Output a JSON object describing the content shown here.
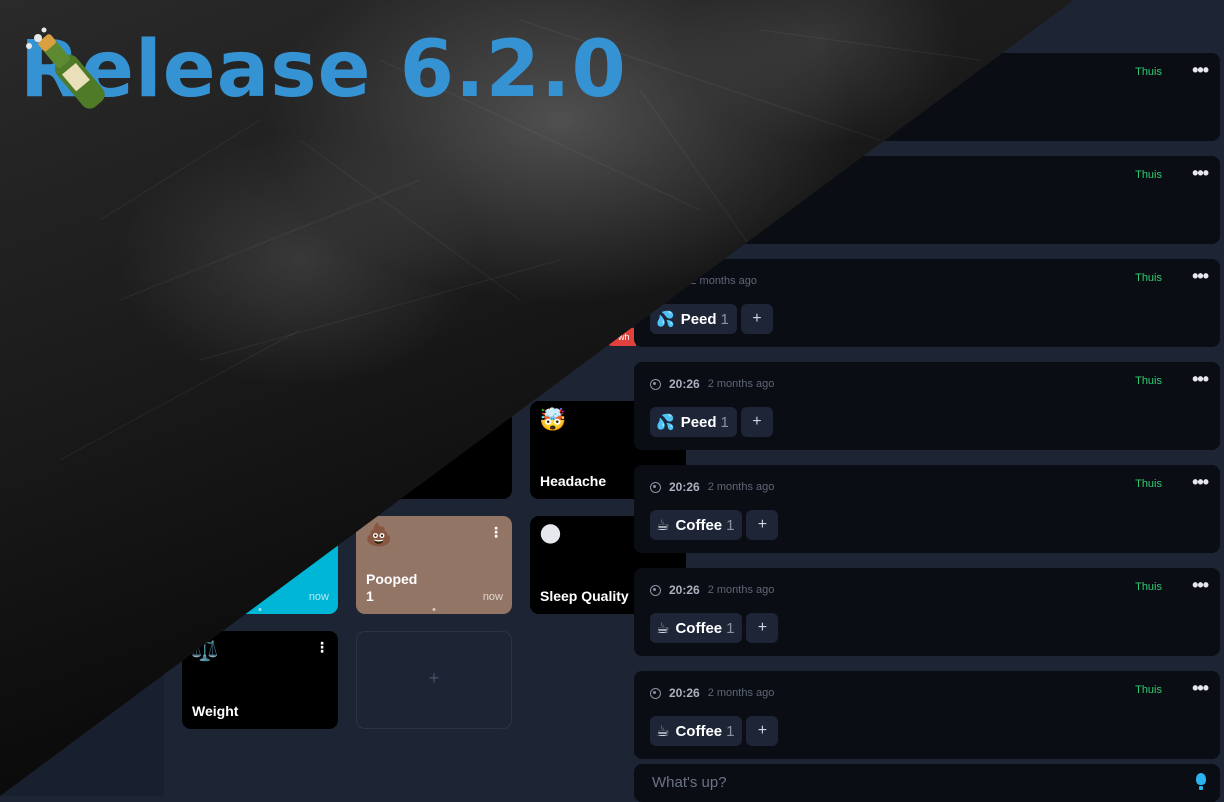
{
  "hero": {
    "title": "Release 6.2.0",
    "icon": "champagne-bottle-icon"
  },
  "tiles": {
    "headache": {
      "emoji": "🤯",
      "label": "Headache"
    },
    "pooped": {
      "emoji": "💩",
      "label": "Pooped",
      "count": "1",
      "time": "now",
      "color": "#937566"
    },
    "cyan": {
      "time": "now",
      "color": "#00b6d6"
    },
    "sleep": {
      "emoji": "🌑",
      "label": "Sleep Quality"
    },
    "weight": {
      "emoji": "⚖️",
      "label": "Weight"
    },
    "add": {
      "label": "+"
    },
    "red_chip": {
      "text": "wh"
    }
  },
  "feed": {
    "cards": [
      {
        "time": "",
        "ago": "",
        "tag": "Thuis",
        "menu": "•••",
        "chips": []
      },
      {
        "time": "",
        "ago": "",
        "tag": "Thuis",
        "menu": "•••",
        "chips": []
      },
      {
        "time": "26",
        "ago": "2 months ago",
        "tag": "Thuis",
        "menu": "•••",
        "chips": [
          {
            "emoji": "💦",
            "label": "Peed",
            "count": "1"
          }
        ]
      },
      {
        "time": "20:26",
        "ago": "2 months ago",
        "tag": "Thuis",
        "menu": "•••",
        "chips": [
          {
            "emoji": "💦",
            "label": "Peed",
            "count": "1"
          }
        ]
      },
      {
        "time": "20:26",
        "ago": "2 months ago",
        "tag": "Thuis",
        "menu": "•••",
        "chips": [
          {
            "emoji": "☕",
            "label": "Coffee",
            "count": "1"
          }
        ]
      },
      {
        "time": "20:26",
        "ago": "2 months ago",
        "tag": "Thuis",
        "menu": "•••",
        "chips": [
          {
            "emoji": "☕",
            "label": "Coffee",
            "count": "1"
          }
        ]
      },
      {
        "time": "20:26",
        "ago": "2 months ago",
        "tag": "Thuis",
        "menu": "•••",
        "chips": [
          {
            "emoji": "☕",
            "label": "Coffee",
            "count": "1"
          }
        ]
      }
    ],
    "add_label": "+"
  },
  "composer": {
    "placeholder": "What's up?",
    "icon": "lightbulb-icon"
  },
  "colors": {
    "accent": "#3693d3",
    "tag": "#2ecc71",
    "card_bg": "#0a0d13",
    "app_bg": "#1d2433"
  }
}
